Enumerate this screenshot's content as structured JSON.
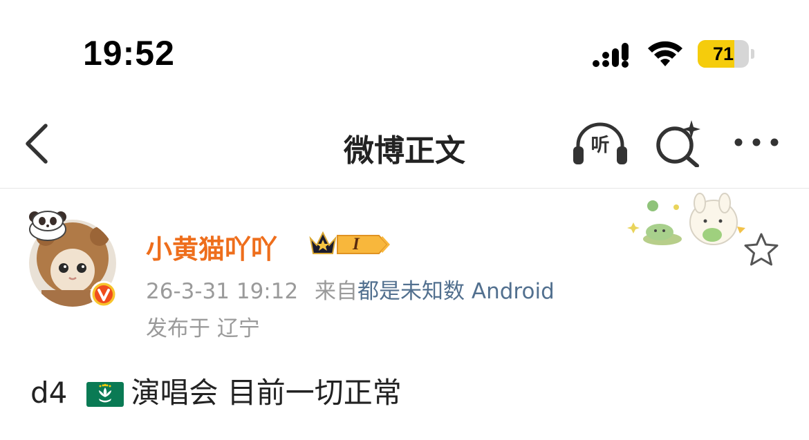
{
  "status_bar": {
    "time": "19:52",
    "battery_level": "71",
    "battery_fraction": 0.71,
    "icons": [
      "cellular-signal-icon",
      "wifi-icon",
      "battery-icon"
    ]
  },
  "nav": {
    "title": "微博正文",
    "listen_label": "听",
    "icons": [
      "back-arrow-icon",
      "listen-headphones-icon",
      "ai-search-icon",
      "more-icon"
    ]
  },
  "post": {
    "username": "小黄猫吖吖",
    "level_badge": "I",
    "timestamp": "26-3-31 19:12",
    "source_prefix": "来自",
    "source": "都是未知数 Android",
    "location": "发布于 辽宁",
    "text_prefix": "d4",
    "text_body": "演唱会  目前一切正常",
    "icons": [
      "avatar",
      "verified-badge-icon",
      "crown-icon",
      "sticker-decoration",
      "favorite-star-icon",
      "macau-flag-emoji"
    ]
  },
  "colors": {
    "username": "#ee6e1c",
    "source_link": "#52708f",
    "meta_gray": "#9a9a9a",
    "battery_fill": "#f5cc0c",
    "verified": "#f04d1c"
  }
}
